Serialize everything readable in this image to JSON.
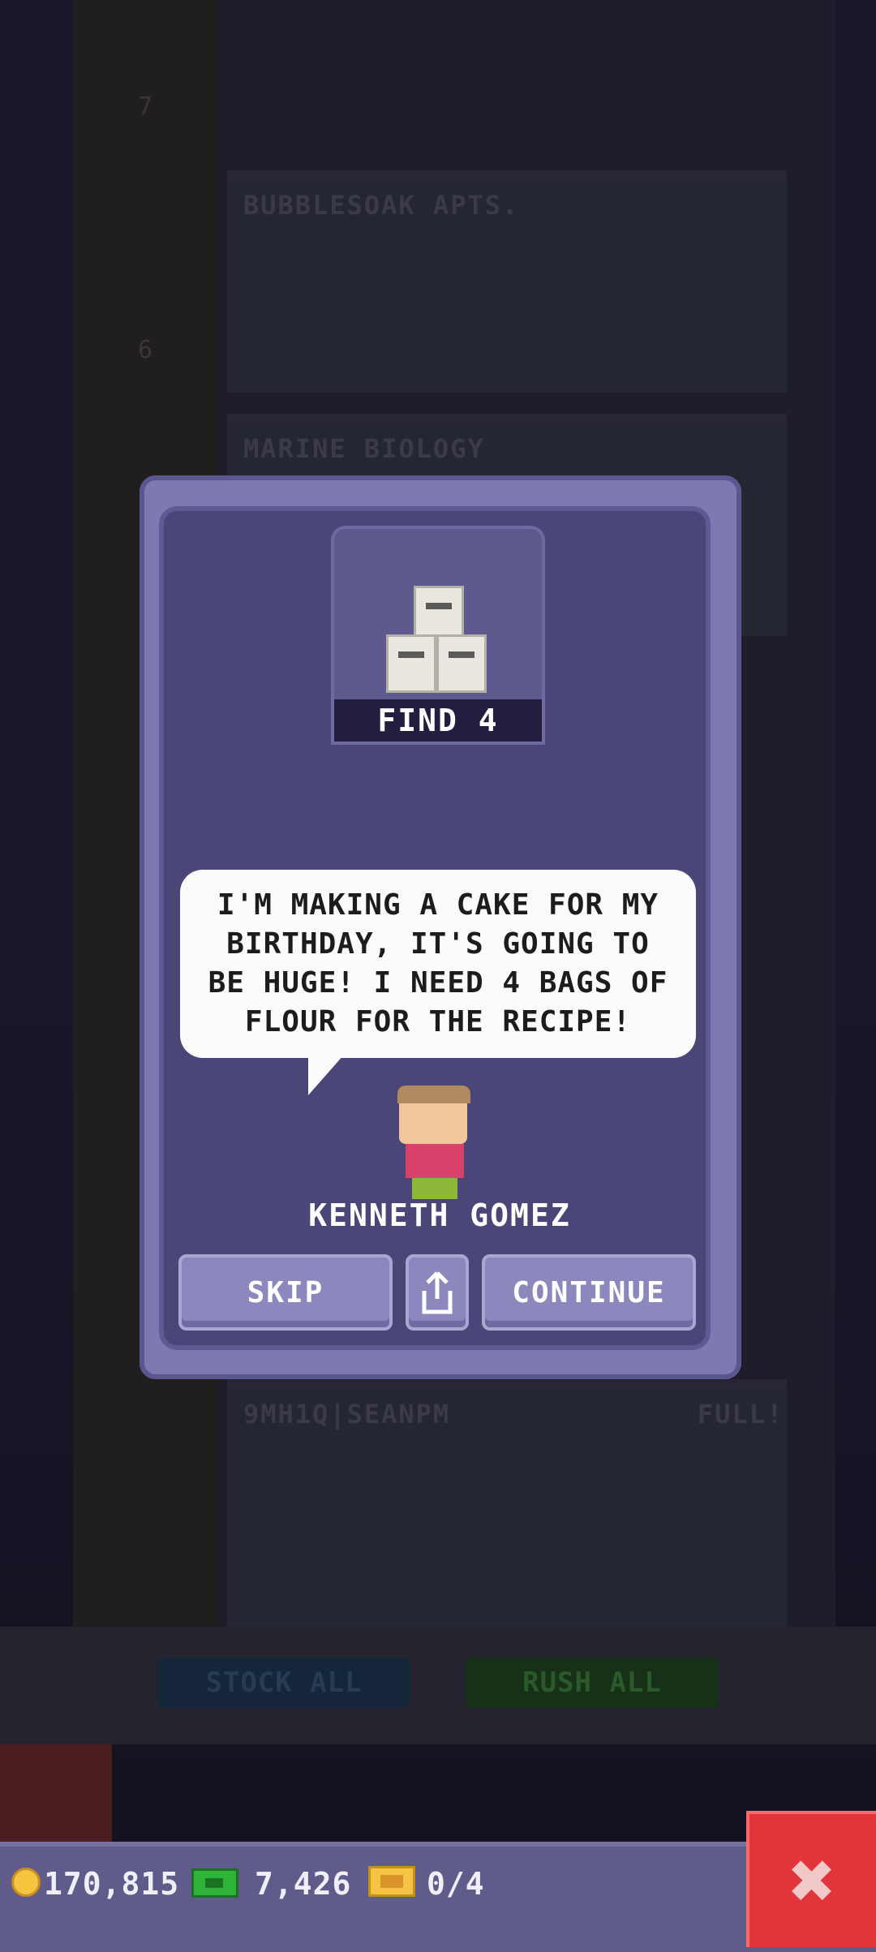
{
  "background": {
    "floors": [
      {
        "name": "BUBBLESOAK APTS.",
        "number": "7"
      },
      {
        "name": "MARINE BIOLOGY",
        "number": "6"
      },
      {
        "name": "9MH1Q|SEANPM",
        "status": "FULL!"
      }
    ],
    "stock_all_label": "STOCK ALL",
    "rush_all_label": "RUSH ALL"
  },
  "mission": {
    "item_label": "FIND 4",
    "item_icon": "flour-bags-icon",
    "message": "I'M MAKING A CAKE FOR MY BIRTHDAY, IT'S GOING TO BE HUGE! I NEED 4 BAGS OF FLOUR FOR THE RECIPE!",
    "character_name": "KENNETH GOMEZ",
    "skip_label": "SKIP",
    "continue_label": "CONTINUE"
  },
  "resources": {
    "coins": "170,815",
    "bux": "7,426",
    "tickets": "0/4"
  },
  "colors": {
    "dialog_frame": "#7f79b3",
    "dialog_inner": "#4a4677",
    "close_button": "#e2343b"
  }
}
